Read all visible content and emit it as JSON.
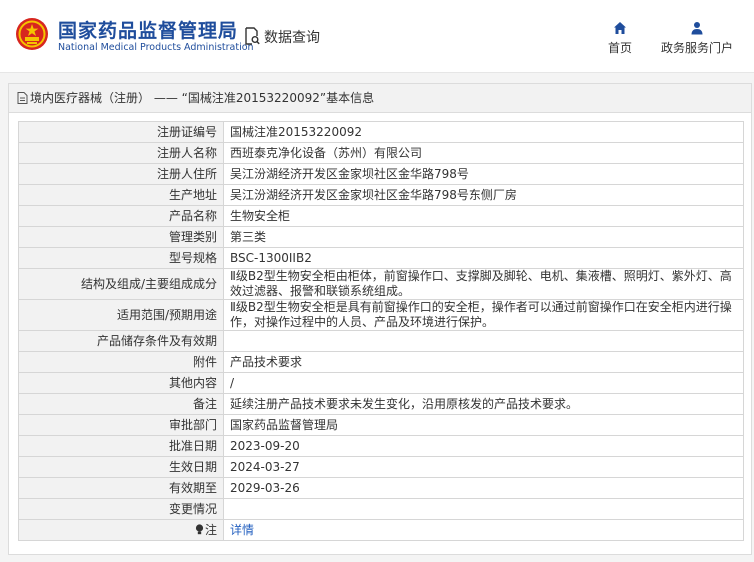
{
  "header": {
    "site_name_cn": "国家药品监督管理局",
    "site_name_en": "National Medical Products Administration",
    "query_label": "数据查询",
    "nav": {
      "home_label": "首页",
      "portal_label": "政务服务门户"
    }
  },
  "breadcrumb": {
    "category": "境内医疗器械（注册）",
    "separator": " —— ",
    "title": "“国械注准20153220092”基本信息"
  },
  "rows": [
    {
      "label": "注册证编号",
      "value": "国械注准20153220092"
    },
    {
      "label": "注册人名称",
      "value": "西班泰克净化设备（苏州）有限公司"
    },
    {
      "label": "注册人住所",
      "value": "吴江汾湖经济开发区金家坝社区金华路798号"
    },
    {
      "label": "生产地址",
      "value": "吴江汾湖经济开发区金家坝社区金华路798号东侧厂房"
    },
    {
      "label": "产品名称",
      "value": "生物安全柜"
    },
    {
      "label": "管理类别",
      "value": "第三类"
    },
    {
      "label": "型号规格",
      "value": "BSC-1300IIB2"
    },
    {
      "label": "结构及组成/主要组成成分",
      "value": "Ⅱ级B2型生物安全柜由柜体，前窗操作口、支撑脚及脚轮、电机、集液槽、照明灯、紫外灯、高效过滤器、报警和联锁系统组成。"
    },
    {
      "label": "适用范围/预期用途",
      "value": "Ⅱ级B2型生物安全柜是具有前窗操作口的安全柜，操作者可以通过前窗操作口在安全柜内进行操作，对操作过程中的人员、产品及环境进行保护。"
    },
    {
      "label": "产品储存条件及有效期",
      "value": ""
    },
    {
      "label": "附件",
      "value": "产品技术要求"
    },
    {
      "label": "其他内容",
      "value": "/"
    },
    {
      "label": "备注",
      "value": "延续注册产品技术要求未发生变化，沿用原核发的产品技术要求。"
    },
    {
      "label": "审批部门",
      "value": "国家药品监督管理局"
    },
    {
      "label": "批准日期",
      "value": "2023-09-20"
    },
    {
      "label": "生效日期",
      "value": "2024-03-27"
    },
    {
      "label": "有效期至",
      "value": "2029-03-26"
    },
    {
      "label": "变更情况",
      "value": ""
    }
  ],
  "note_row": {
    "label": "注",
    "link_text": "详情"
  },
  "colors": {
    "brand_blue": "#1f4d9c",
    "emblem_red": "#d7261f",
    "link_blue": "#2460c0",
    "label_bg": "#f2f2f2"
  },
  "icons": {
    "emblem": "national-emblem-icon",
    "query": "document-search-icon",
    "home": "home-icon",
    "portal": "user-icon",
    "breadcrumb": "document-icon",
    "note": "bulb-icon"
  }
}
